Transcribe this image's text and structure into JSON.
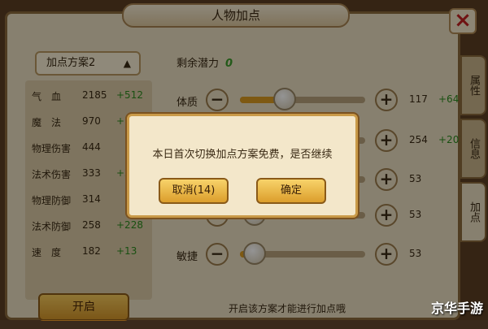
{
  "title": "人物加点",
  "close_icon": "close-icon",
  "plan": {
    "label": "加点方案2",
    "chevron": "▲"
  },
  "stats": [
    {
      "name": "气　血",
      "value": "2185",
      "bonus": "+512"
    },
    {
      "name": "魔　法",
      "value": "970",
      "bonus": "+1005"
    },
    {
      "name": "物理伤害",
      "value": "444",
      "bonus": ""
    },
    {
      "name": "法术伤害",
      "value": "333",
      "bonus": "+20"
    },
    {
      "name": "物理防御",
      "value": "314",
      "bonus": ""
    },
    {
      "name": "法术防御",
      "value": "258",
      "bonus": "+228"
    },
    {
      "name": "速　度",
      "value": "182",
      "bonus": "+13"
    }
  ],
  "open_button": "开启",
  "remaining": {
    "label": "剩余潜力",
    "value": "0"
  },
  "attributes": [
    {
      "label": "体质",
      "points": "117",
      "bonus": "+64",
      "level": 0.36
    },
    {
      "label": "",
      "points": "254",
      "bonus": "+201",
      "level": 0.5
    },
    {
      "label": "",
      "points": "53",
      "bonus": "",
      "level": 0.12
    },
    {
      "label": "",
      "points": "53",
      "bonus": "",
      "level": 0.12
    },
    {
      "label": "敏捷",
      "points": "53",
      "bonus": "",
      "level": 0.12
    }
  ],
  "hint": "开启该方案才能进行加点哦",
  "tabs": [
    {
      "label": "属性",
      "active": false
    },
    {
      "label": "信息",
      "active": false
    },
    {
      "label": "加点",
      "active": true
    }
  ],
  "dialog": {
    "message": "本日首次切换加点方案免费，是否继续",
    "cancel": "取消(14)",
    "confirm": "确定"
  },
  "watermark": "京华手游"
}
